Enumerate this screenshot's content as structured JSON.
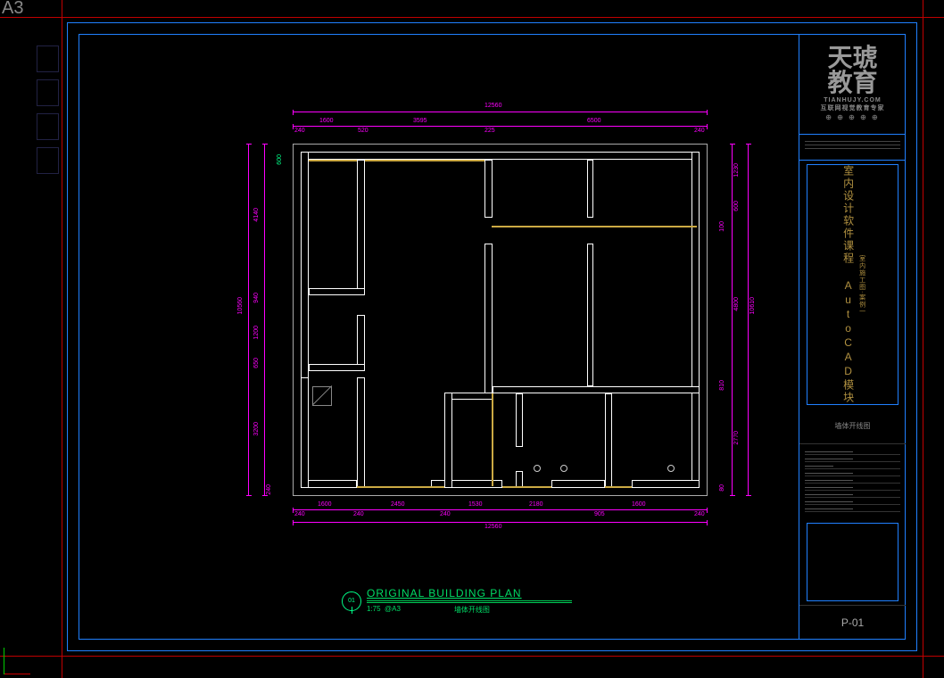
{
  "paper_size": "A3",
  "titleblock": {
    "logo_line1": "天琥",
    "logo_line2": "教育",
    "logo_url": "TIANHUJY.COM",
    "logo_tagline": "互联网视觉教育专家",
    "course_title_1": "室内设计软件课程",
    "course_title_2": "AutoCAD模块",
    "course_subtitle": "室内施工图·案例一",
    "drawing_name": "墙体开线图",
    "page_number": "P-01"
  },
  "plan_title": {
    "number": "01",
    "english": "ORIGINAL BUILDING PLAN",
    "scale": "1:75",
    "sheet": "@A3",
    "chinese": "墙体开线图"
  },
  "dimensions": {
    "top_overall": "12560",
    "top_segments": [
      "240",
      "1600",
      "520",
      "3595",
      "225",
      "6500",
      "240"
    ],
    "bottom_overall": "12560",
    "bottom_segments": [
      "240",
      "1600",
      "240",
      "2450",
      "240",
      "1530",
      "2180",
      "905",
      "1600",
      "240"
    ],
    "left_overall": "10560",
    "left_segments_top": [
      "4140"
    ],
    "left_segments_mid": [
      "940",
      "1200",
      "650"
    ],
    "left_segments_bot": [
      "3200",
      "240"
    ],
    "right_overall": "10610",
    "right_segments": [
      "1230",
      "600",
      "100",
      "4800",
      "810",
      "2770",
      "80"
    ],
    "green_left": "600"
  }
}
